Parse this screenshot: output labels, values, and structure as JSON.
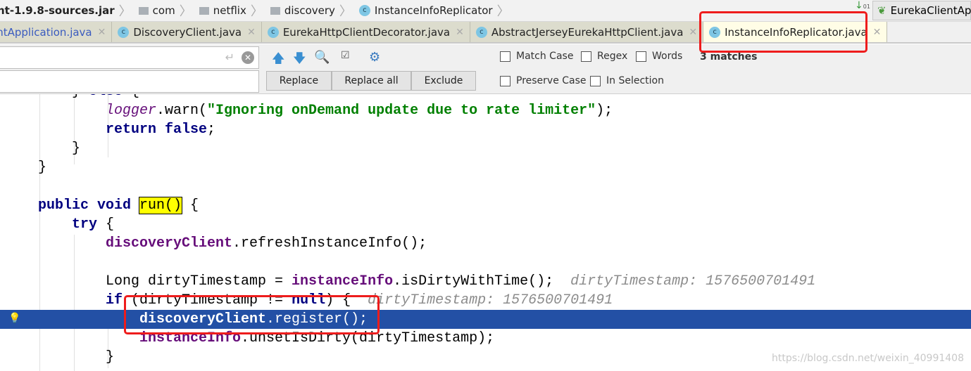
{
  "breadcrumb": [
    {
      "label": "nt-1.9.8-sources.jar",
      "icon": "jar",
      "bold": true
    },
    {
      "label": "com",
      "icon": "folder-icon"
    },
    {
      "label": "netflix",
      "icon": "folder-icon"
    },
    {
      "label": "discovery",
      "icon": "folder-icon"
    },
    {
      "label": "InstanceInfoReplicator",
      "icon": "class-icon"
    }
  ],
  "run_config": {
    "label": "EurekaClientAp",
    "icon": "spring-boot-icon"
  },
  "tabs": [
    {
      "label": "entApplication.java",
      "active": false
    },
    {
      "label": "DiscoveryClient.java",
      "active": false
    },
    {
      "label": "EurekaHttpClientDecorator.java",
      "active": false
    },
    {
      "label": "AbstractJerseyEurekaHttpClient.java",
      "active": false
    },
    {
      "label": "InstanceInfoReplicator.java",
      "active": true
    }
  ],
  "find": {
    "search_value": "",
    "replace_value": "",
    "buttons": {
      "replace": "Replace",
      "replace_all": "Replace all",
      "exclude": "Exclude"
    },
    "options": {
      "match_case": "Match Case",
      "regex": "Regex",
      "words": "Words",
      "preserve_case": "Preserve Case",
      "in_selection": "In Selection"
    },
    "matches": "3 matches"
  },
  "code": [
    {
      "indent": 4,
      "tokens": [
        [
          "} ",
          "plain"
        ],
        [
          "else",
          "kw"
        ],
        [
          " {",
          "plain"
        ]
      ]
    },
    {
      "indent": 8,
      "tokens": [
        [
          "logger",
          "sfld"
        ],
        [
          ".warn(",
          "plain"
        ],
        [
          "\"Ignoring onDemand update due to rate limiter\"",
          "str"
        ],
        [
          ");",
          "plain"
        ]
      ]
    },
    {
      "indent": 8,
      "tokens": [
        [
          "return false",
          "kw"
        ],
        [
          ";",
          "plain"
        ]
      ]
    },
    {
      "indent": 4,
      "tokens": [
        [
          "}",
          "plain"
        ]
      ]
    },
    {
      "indent": 0,
      "tokens": [
        [
          "}",
          "plain"
        ]
      ]
    },
    {
      "indent": 0,
      "tokens": []
    },
    {
      "indent": 0,
      "tokens": [
        [
          "public void ",
          "kw"
        ],
        [
          "run()",
          "match"
        ],
        [
          " {",
          "plain"
        ]
      ]
    },
    {
      "indent": 4,
      "tokens": [
        [
          "try",
          "kw"
        ],
        [
          " {",
          "plain"
        ]
      ]
    },
    {
      "indent": 8,
      "tokens": [
        [
          "discoveryClient",
          "fld"
        ],
        [
          ".refreshInstanceInfo();",
          "plain"
        ]
      ]
    },
    {
      "indent": 8,
      "tokens": []
    },
    {
      "indent": 8,
      "tokens": [
        [
          "Long dirtyTimestamp = ",
          "plain"
        ],
        [
          "instanceInfo",
          "fld"
        ],
        [
          ".isDirtyWithTime();",
          "plain"
        ],
        [
          "  dirtyTimestamp: 1576500701491",
          "hint"
        ]
      ]
    },
    {
      "indent": 8,
      "tokens": [
        [
          "if",
          "kw"
        ],
        [
          " (dirtyTimestamp != ",
          "plain"
        ],
        [
          "null",
          "kw"
        ],
        [
          ") {",
          "plain"
        ],
        [
          "  dirtyTimestamp: 1576500701491",
          "hint"
        ]
      ]
    },
    {
      "indent": 12,
      "tokens": [
        [
          "discoveryClient",
          "fld"
        ],
        [
          ".register();",
          "plain"
        ]
      ],
      "current": true
    },
    {
      "indent": 12,
      "tokens": [
        [
          "instanceInfo",
          "fld"
        ],
        [
          ".unsetIsDirty(dirtyTimestamp);",
          "plain"
        ]
      ]
    },
    {
      "indent": 8,
      "tokens": [
        [
          "}",
          "plain"
        ]
      ]
    }
  ],
  "watermark": "https://blog.csdn.net/weixin_40991408"
}
